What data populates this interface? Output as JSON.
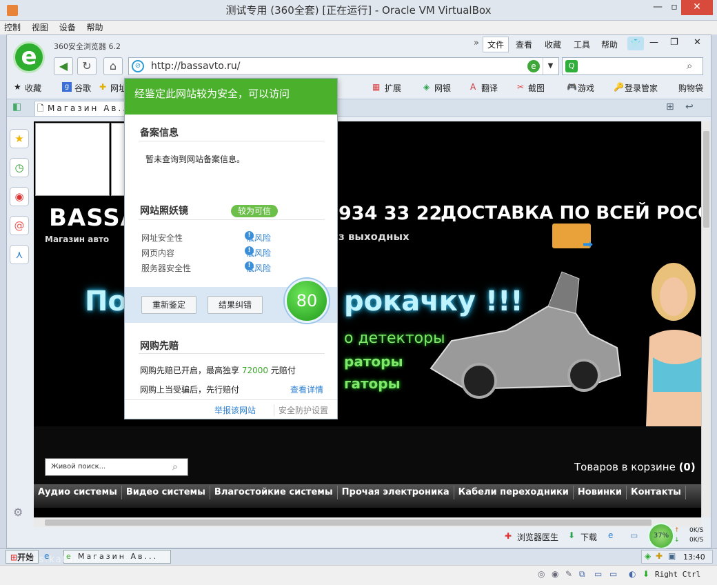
{
  "window": {
    "title": "测试专用 (360全套) [正在运行] - Oracle VM VirtualBox"
  },
  "vb_menu": [
    "控制",
    "视图",
    "设备",
    "帮助"
  ],
  "browser": {
    "name": "360安全浏览器 6.2",
    "url": "http://bassavto.ru/",
    "menu": [
      "文件",
      "查看",
      "收藏",
      "工具",
      "帮助"
    ],
    "history_icon": "»"
  },
  "favbar": {
    "items": [
      "收藏",
      "谷歌",
      "网址"
    ],
    "right": [
      "扩展",
      "网银",
      "翻译",
      "截图",
      "游戏",
      "登录管家",
      "购物袋"
    ]
  },
  "tab": {
    "title": "Магазин Ав..."
  },
  "popup": {
    "header": "经鉴定此网站较为安全，可以访问",
    "beian_title": "备案信息",
    "beian_text": "暂未查询到网站备案信息。",
    "mirror_title": "网站照妖镜",
    "mirror_badge": "较为可信",
    "rows": [
      {
        "label": "网址安全性",
        "value": "低风险"
      },
      {
        "label": "网页内容",
        "value": "低风险"
      },
      {
        "label": "服务器安全性",
        "value": "低风险"
      }
    ],
    "btn_recheck": "重新鉴定",
    "btn_correct": "结果纠错",
    "score": "80",
    "shop_title": "网购先赔",
    "shop_text1_a": "网购先赔已开启，最高独享 ",
    "shop_amount": "72000",
    "shop_text1_b": " 元赔付",
    "shop_text2": "网购上当受骗后，先行赔付",
    "shop_detail": "查看详情",
    "footer_report": "举报该网站",
    "footer_settings": "安全防护设置"
  },
  "site": {
    "logo": "BASSA",
    "logo_sub": "Магазин авто",
    "phone": "934 33 22",
    "delivery": "ДОСТАВКА ПО ВСЕЙ РОССИИ",
    "weekend": "з выходных",
    "big_left": "По",
    "big_right": "рокачку !!!",
    "line1": "о детекторы",
    "line2": "раторы",
    "line3": "гаторы",
    "search_placeholder": "Живой поиск...",
    "cart_label": "Товаров в корзине ",
    "cart_count": "(0)",
    "nav": [
      "Аудио системы",
      "Видео системы",
      "Влагостойкие системы",
      "Прочая электроника",
      "Кабели переходники",
      "Новинки",
      "Контакты"
    ]
  },
  "statusbar": {
    "doctor": "浏览器医生",
    "download": "下载",
    "percent": "37%",
    "speed_up": "0K/S",
    "speed_down": "0K/S"
  },
  "taskbar": {
    "start": "开始",
    "task": "Магазин Ав...",
    "time": "13:40",
    "watermark": "bbs.kafan.cn"
  },
  "vbstatus": {
    "host_key": "Right Ctrl"
  }
}
